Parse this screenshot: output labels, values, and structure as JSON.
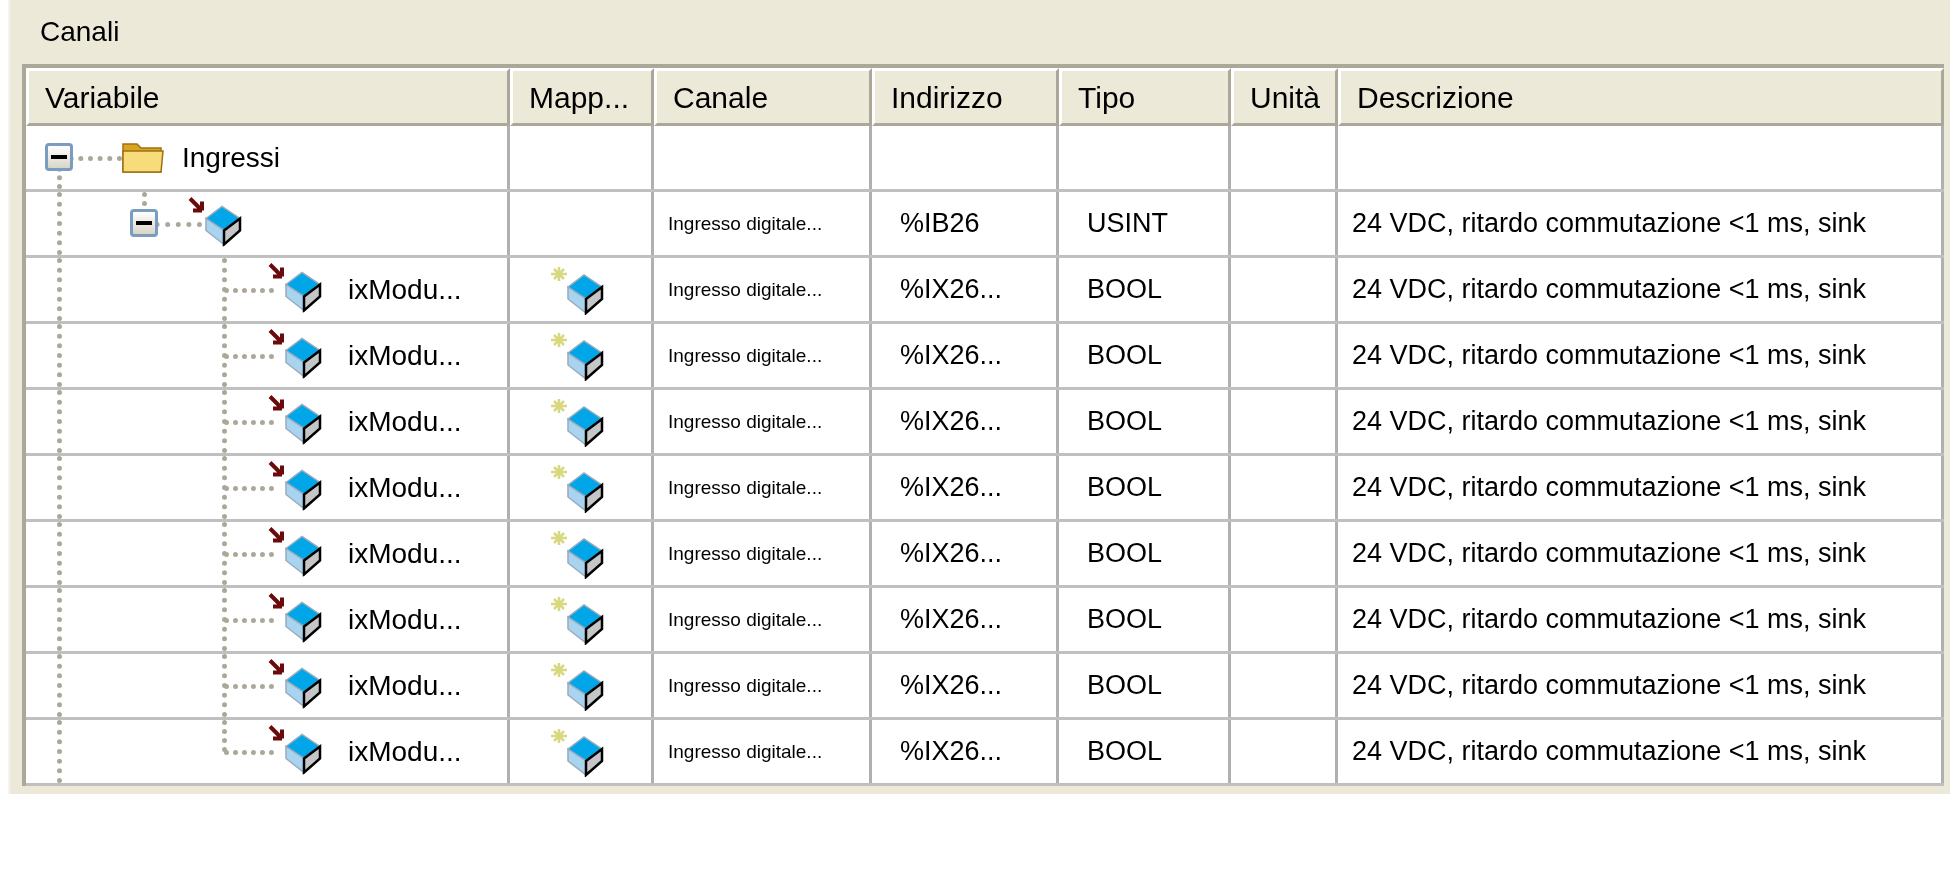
{
  "panel": {
    "title": "Canali"
  },
  "table": {
    "columns": [
      "Variabile",
      "Mapp...",
      "Canale",
      "Indirizzo",
      "Tipo",
      "Unità",
      "Descrizione"
    ],
    "rows": [
      {
        "kind": "folder",
        "variable": "Ingressi",
        "expanded": true,
        "children": [
          {
            "kind": "module",
            "expanded": true,
            "channel": "Ingresso digitale...",
            "address": "%IB26",
            "type": "USINT",
            "description": "24 VDC, ritardo commutazione <1 ms, sink",
            "children": [
              {
                "kind": "channel",
                "variable": "ixModu...",
                "channel": "Ingresso digitale...",
                "address": "%IX26...",
                "type": "BOOL",
                "description": "24 VDC, ritardo commutazione <1 ms, sink"
              },
              {
                "kind": "channel",
                "variable": "ixModu...",
                "channel": "Ingresso digitale...",
                "address": "%IX26...",
                "type": "BOOL",
                "description": "24 VDC, ritardo commutazione <1 ms, sink"
              },
              {
                "kind": "channel",
                "variable": "ixModu...",
                "channel": "Ingresso digitale...",
                "address": "%IX26...",
                "type": "BOOL",
                "description": "24 VDC, ritardo commutazione <1 ms, sink"
              },
              {
                "kind": "channel",
                "variable": "ixModu...",
                "channel": "Ingresso digitale...",
                "address": "%IX26...",
                "type": "BOOL",
                "description": "24 VDC, ritardo commutazione <1 ms, sink"
              },
              {
                "kind": "channel",
                "variable": "ixModu...",
                "channel": "Ingresso digitale...",
                "address": "%IX26...",
                "type": "BOOL",
                "description": "24 VDC, ritardo commutazione <1 ms, sink"
              },
              {
                "kind": "channel",
                "variable": "ixModu...",
                "channel": "Ingresso digitale...",
                "address": "%IX26...",
                "type": "BOOL",
                "description": "24 VDC, ritardo commutazione <1 ms, sink"
              },
              {
                "kind": "channel",
                "variable": "ixModu...",
                "channel": "Ingresso digitale...",
                "address": "%IX26...",
                "type": "BOOL",
                "description": "24 VDC, ritardo commutazione <1 ms, sink"
              },
              {
                "kind": "channel",
                "variable": "ixModu...",
                "channel": "Ingresso digitale...",
                "address": "%IX26...",
                "type": "BOOL",
                "description": "24 VDC, ritardo commutazione <1 ms, sink"
              }
            ]
          }
        ]
      }
    ]
  }
}
